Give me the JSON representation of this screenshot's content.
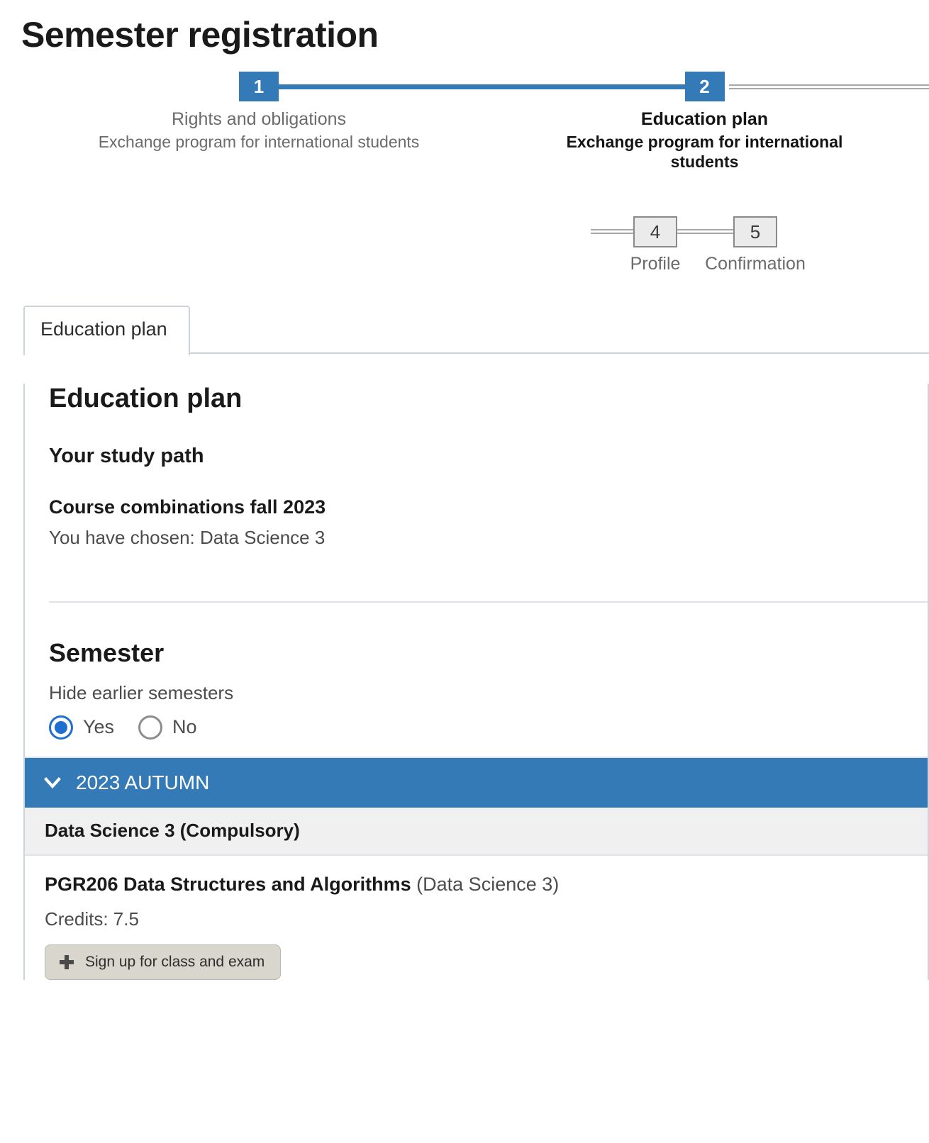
{
  "page": {
    "title": "Semester registration"
  },
  "stepper": {
    "steps": [
      {
        "number": "1",
        "label": "Rights and obligations",
        "sublabel": "Exchange program for international students",
        "state": "done"
      },
      {
        "number": "2",
        "label": "Education plan",
        "sublabel": "Exchange program for international students",
        "state": "current"
      },
      {
        "number": "4",
        "label": "Profile",
        "sublabel": "",
        "state": "pending"
      },
      {
        "number": "5",
        "label": "Confirmation",
        "sublabel": "",
        "state": "pending"
      }
    ]
  },
  "tabs": [
    {
      "label": "Education plan",
      "active": true
    }
  ],
  "main": {
    "heading": "Education plan",
    "study_path_heading": "Your study path",
    "combination_heading": "Course combinations fall 2023",
    "chosen_text": "You have chosen: Data Science 3",
    "semester_heading": "Semester",
    "hide_earlier_label": "Hide earlier semesters",
    "radio_options": [
      {
        "label": "Yes",
        "checked": true
      },
      {
        "label": "No",
        "checked": false
      }
    ],
    "semester_group": {
      "title": "2023 AUTUMN",
      "expanded": true,
      "category": "Data Science 3 (Compulsory)",
      "courses": [
        {
          "code_and_name": "PGR206 Data Structures and Algorithms",
          "program": "(Data Science 3)",
          "credits_label": "Credits: 7.5",
          "action_label": "Sign up for class and exam"
        }
      ]
    }
  },
  "colors": {
    "accent_blue": "#337ab7",
    "radio_blue": "#1f6fd0",
    "group_grey": "#f0f0f0",
    "button_beige": "#d8d6cd"
  }
}
